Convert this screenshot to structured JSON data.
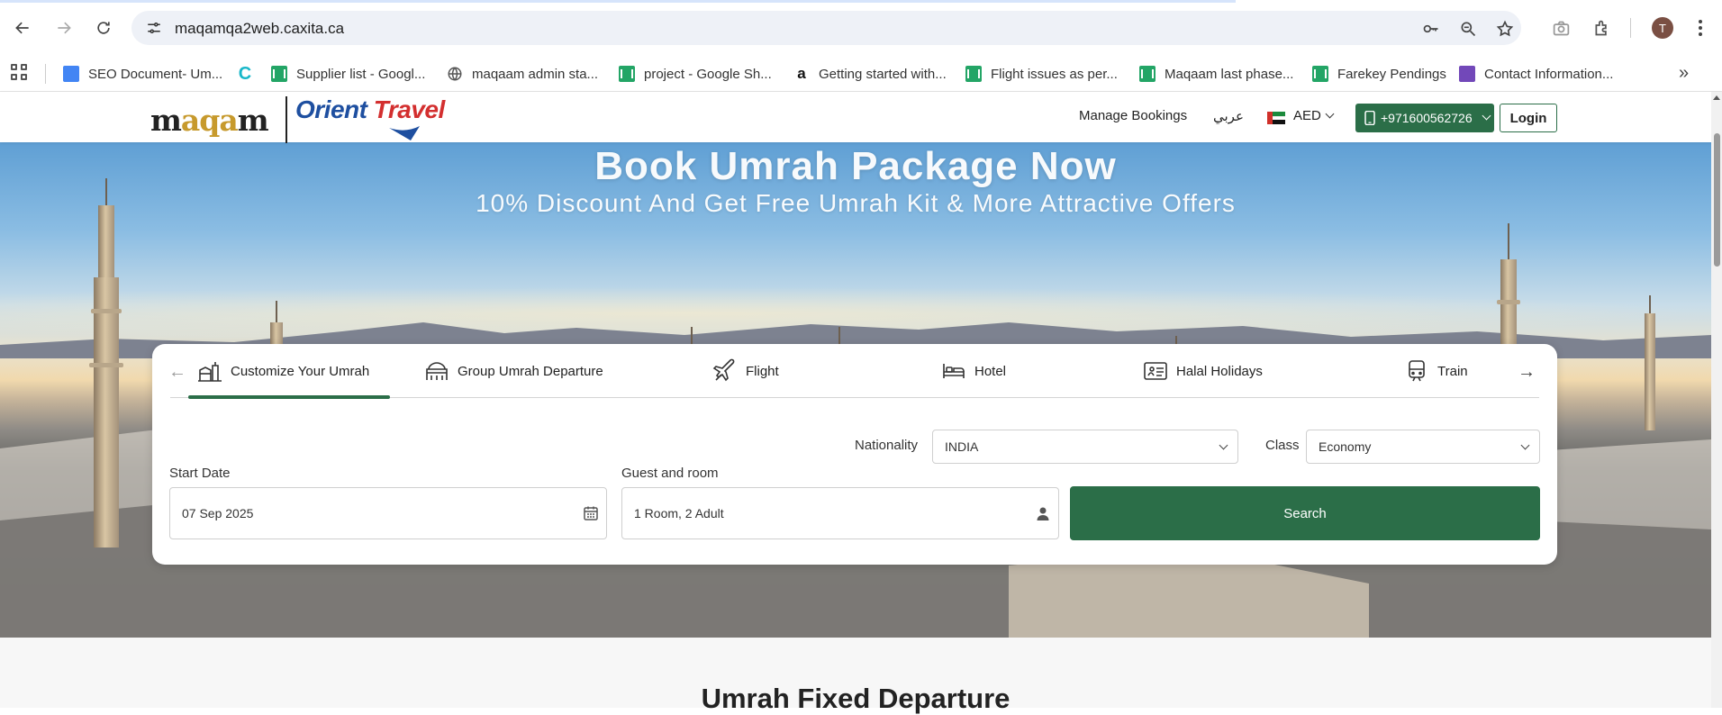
{
  "browser": {
    "url": "maqamqa2web.caxita.ca",
    "profile_initial": "T",
    "bookmarks": [
      {
        "label": "SEO Document- Um...",
        "icon": "google-docs-icon"
      },
      {
        "label": "",
        "icon": "caxita-c-icon"
      },
      {
        "label": "Supplier list - Googl...",
        "icon": "google-sheets-icon"
      },
      {
        "label": "maqaam admin sta...",
        "icon": "globe-icon"
      },
      {
        "label": "project - Google Sh...",
        "icon": "google-sheets-icon"
      },
      {
        "label": "Getting started with...",
        "icon": "amazon-icon"
      },
      {
        "label": "Flight issues as per...",
        "icon": "google-sheets-icon"
      },
      {
        "label": "Maqaam last phase...",
        "icon": "google-sheets-icon"
      },
      {
        "label": "Farekey Pendings",
        "icon": "google-sheets-icon"
      },
      {
        "label": "Contact Information...",
        "icon": "google-forms-icon"
      }
    ]
  },
  "header": {
    "logo_left": "MAQAM",
    "logo_right": "Orient Travel",
    "manage_bookings": "Manage Bookings",
    "language": "عربي",
    "currency": "AED",
    "phone": "+971600562726",
    "login": "Login"
  },
  "hero": {
    "title": "Book Umrah Package Now",
    "subtitle": "10% Discount And Get Free Umrah Kit & More Attractive Offers"
  },
  "search": {
    "tabs": [
      {
        "label": "Customize Your Umrah",
        "icon": "kaaba-icon",
        "active": true
      },
      {
        "label": "Group Umrah Departure",
        "icon": "mosque-icon",
        "active": false
      },
      {
        "label": "Flight",
        "icon": "plane-icon",
        "active": false
      },
      {
        "label": "Hotel",
        "icon": "bed-icon",
        "active": false
      },
      {
        "label": "Halal Holidays",
        "icon": "holiday-icon",
        "active": false
      },
      {
        "label": "Train",
        "icon": "train-icon",
        "active": false
      }
    ],
    "nationality_label": "Nationality",
    "nationality_value": "INDIA",
    "class_label": "Class",
    "class_value": "Economy",
    "start_date_label": "Start Date",
    "start_date_value": "07 Sep 2025",
    "guest_label": "Guest and room",
    "guest_value": "1 Room, 2 Adult",
    "search_button": "Search"
  },
  "section": {
    "title": "Umrah Fixed Departure"
  },
  "colors": {
    "brand_green": "#2b6e48",
    "orient_blue": "#1e4fa0",
    "maqam_gold": "#c79a2d"
  }
}
